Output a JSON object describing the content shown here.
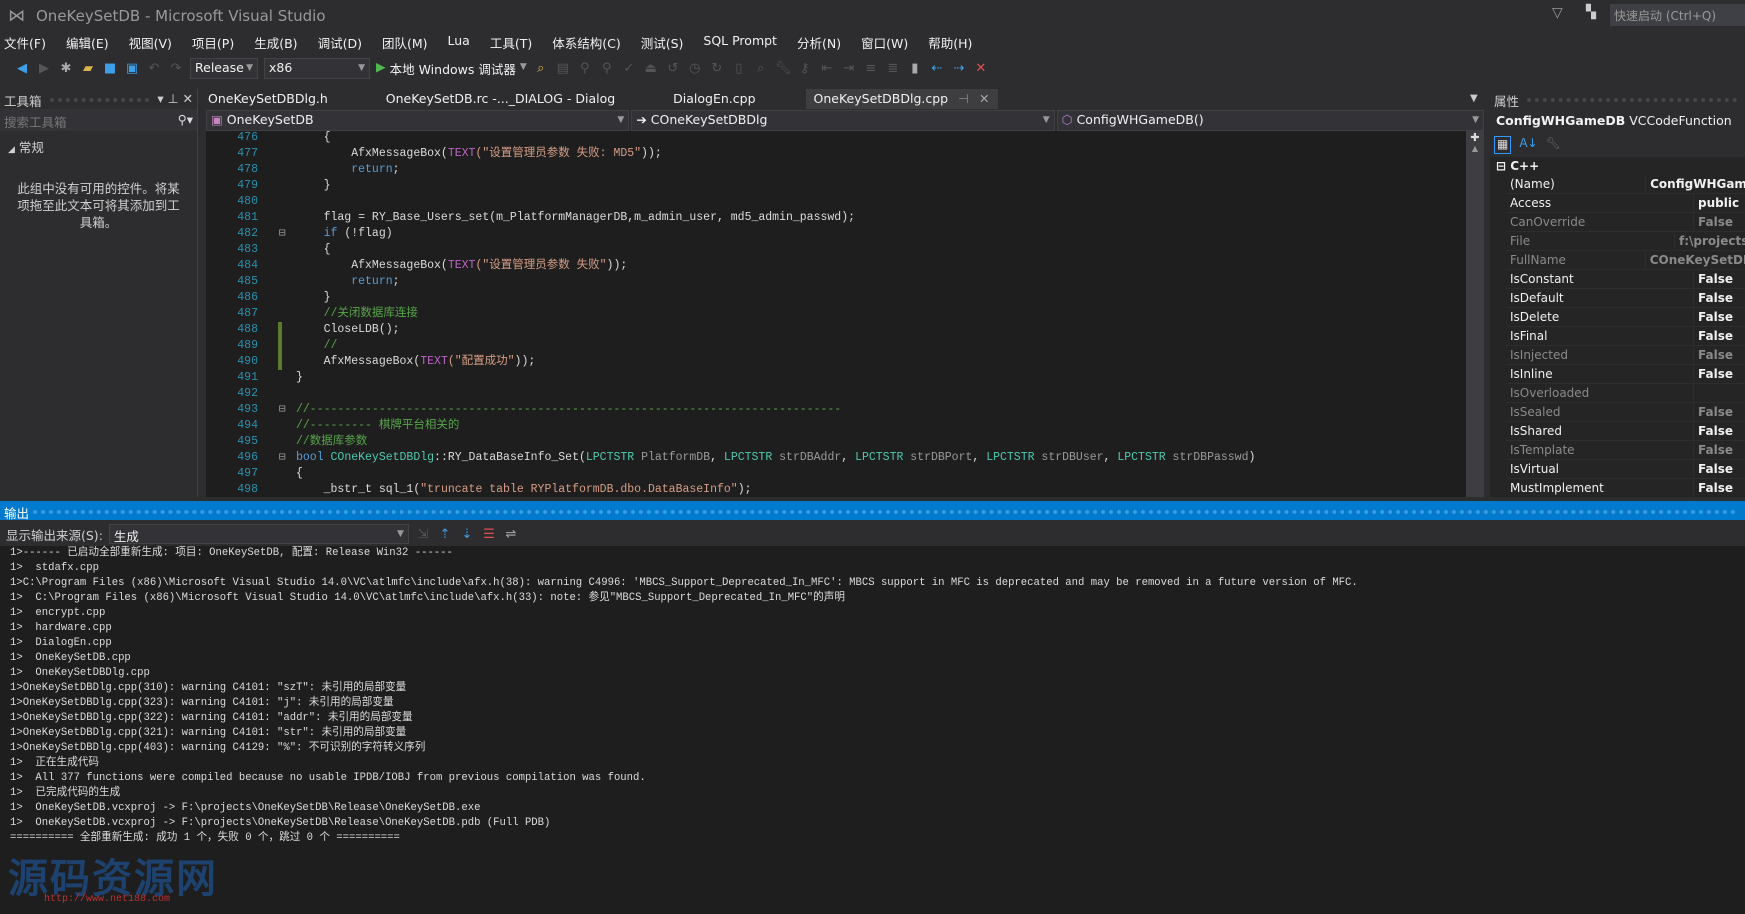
{
  "window": {
    "title": "OneKeySetDB - Microsoft Visual Studio",
    "quick_launch": "快速启动 (Ctrl+Q)"
  },
  "menu": [
    "文件(F)",
    "编辑(E)",
    "视图(V)",
    "项目(P)",
    "生成(B)",
    "调试(D)",
    "团队(M)",
    "Lua",
    "工具(T)",
    "体系结构(C)",
    "测试(S)",
    "SQL Prompt",
    "分析(N)",
    "窗口(W)",
    "帮助(H)"
  ],
  "toolbar": {
    "config": "Release",
    "platform": "x86",
    "run_label": "本地 Windows 调试器"
  },
  "toolbox": {
    "title": "工具箱",
    "search_placeholder": "搜索工具箱",
    "group": "常规",
    "empty_text": "此组中没有可用的控件。将某项拖至此文本可将其添加到工具箱。"
  },
  "tabs": [
    {
      "label": "OneKeySetDBDlg.h"
    },
    {
      "label": "OneKeySetDB.rc -..._DIALOG - Dialog"
    },
    {
      "label": "DialogEn.cpp"
    },
    {
      "label": "OneKeySetDBDlg.cpp",
      "active": true
    }
  ],
  "navbar": {
    "project": "OneKeySetDB",
    "class": "COneKeySetDBDlg",
    "member": "ConfigWHGameDB()"
  },
  "code": [
    {
      "n": "476",
      "t": [
        [
          "tx",
          "    {"
        ]
      ]
    },
    {
      "n": "477",
      "t": [
        [
          "tx",
          "        AfxMessageBox("
        ],
        [
          "mac",
          "TEXT"
        ],
        [
          "str",
          "(\"设置管理员参数 失败: MD5\""
        ],
        [
          "tx",
          "));"
        ]
      ]
    },
    {
      "n": "478",
      "t": [
        [
          "kw",
          "        return"
        ],
        [
          "tx",
          ";"
        ]
      ]
    },
    {
      "n": "479",
      "t": [
        [
          "tx",
          "    }"
        ]
      ]
    },
    {
      "n": "480",
      "t": []
    },
    {
      "n": "481",
      "t": [
        [
          "tx",
          "    flag = RY_Base_Users_set(m_PlatformManagerDB,m_admin_user, md5_admin_passwd);"
        ]
      ]
    },
    {
      "n": "482",
      "f": true,
      "t": [
        [
          "kw",
          "    if"
        ],
        [
          "tx",
          " (!flag)"
        ]
      ]
    },
    {
      "n": "483",
      "t": [
        [
          "tx",
          "    {"
        ]
      ]
    },
    {
      "n": "484",
      "t": [
        [
          "tx",
          "        AfxMessageBox("
        ],
        [
          "mac",
          "TEXT"
        ],
        [
          "str",
          "(\"设置管理员参数 失败\""
        ],
        [
          "tx",
          "));"
        ]
      ]
    },
    {
      "n": "485",
      "t": [
        [
          "kw",
          "        return"
        ],
        [
          "tx",
          ";"
        ]
      ]
    },
    {
      "n": "486",
      "t": [
        [
          "tx",
          "    }"
        ]
      ]
    },
    {
      "n": "487",
      "t": [
        [
          "cm",
          "    //关闭数据库连接"
        ]
      ]
    },
    {
      "n": "488",
      "c": true,
      "t": [
        [
          "tx",
          "    CloseLDB();"
        ]
      ]
    },
    {
      "n": "489",
      "c": true,
      "t": [
        [
          "cm",
          "    //"
        ]
      ]
    },
    {
      "n": "490",
      "c": true,
      "t": [
        [
          "tx",
          "    AfxMessageBox("
        ],
        [
          "mac",
          "TEXT"
        ],
        [
          "str",
          "(\"配置成功\""
        ],
        [
          "tx",
          "));"
        ]
      ]
    },
    {
      "n": "491",
      "t": [
        [
          "tx",
          "}"
        ]
      ]
    },
    {
      "n": "492",
      "t": []
    },
    {
      "n": "493",
      "f": true,
      "t": [
        [
          "cm",
          "//-----------------------------------------------------------------------------"
        ]
      ]
    },
    {
      "n": "494",
      "t": [
        [
          "cm",
          "//--------- 棋牌平台相关的"
        ]
      ]
    },
    {
      "n": "495",
      "t": [
        [
          "cm",
          "//数据库参数"
        ]
      ]
    },
    {
      "n": "496",
      "f": true,
      "t": [
        [
          "kw",
          "bool"
        ],
        [
          "tx",
          " "
        ],
        [
          "ty",
          "COneKeySetDBDlg"
        ],
        [
          "tx",
          "::RY_DataBaseInfo_Set("
        ],
        [
          "ty",
          "LPCTSTR"
        ],
        [
          "pr",
          " PlatformDB"
        ],
        [
          "tx",
          ", "
        ],
        [
          "ty",
          "LPCTSTR"
        ],
        [
          "pr",
          " strDBAddr"
        ],
        [
          "tx",
          ", "
        ],
        [
          "ty",
          "LPCTSTR"
        ],
        [
          "pr",
          " strDBPort"
        ],
        [
          "tx",
          ", "
        ],
        [
          "ty",
          "LPCTSTR"
        ],
        [
          "pr",
          " strDBUser"
        ],
        [
          "tx",
          ", "
        ],
        [
          "ty",
          "LPCTSTR"
        ],
        [
          "pr",
          " strDBPasswd"
        ],
        [
          "tx",
          ")"
        ]
      ]
    },
    {
      "n": "497",
      "t": [
        [
          "tx",
          "{"
        ]
      ]
    },
    {
      "n": "498",
      "t": [
        [
          "tx",
          "    _bstr_t sql_1("
        ],
        [
          "str",
          "\"truncate table RYPlatformDB.dbo.DataBaseInfo\""
        ],
        [
          "tx",
          ");"
        ]
      ]
    }
  ],
  "properties": {
    "title": "属性",
    "object_name": "ConfigWHGameDB",
    "object_type": "VCCodeFunction",
    "category": "C++",
    "rows": [
      {
        "name": "(Name)",
        "value": "ConfigWHGameDB"
      },
      {
        "name": "Access",
        "value": "public"
      },
      {
        "name": "CanOverride",
        "value": "False",
        "dim": true
      },
      {
        "name": "File",
        "value": "f:\\projects",
        "dim": true
      },
      {
        "name": "FullName",
        "value": "COneKeySetDBDlg",
        "dim": true
      },
      {
        "name": "IsConstant",
        "value": "False"
      },
      {
        "name": "IsDefault",
        "value": "False"
      },
      {
        "name": "IsDelete",
        "value": "False"
      },
      {
        "name": "IsFinal",
        "value": "False"
      },
      {
        "name": "IsInjected",
        "value": "False",
        "dim": true
      },
      {
        "name": "IsInline",
        "value": "False"
      },
      {
        "name": "IsOverloaded",
        "value": "",
        "dim": true
      },
      {
        "name": "IsSealed",
        "value": "False",
        "dim": true
      },
      {
        "name": "IsShared",
        "value": "False"
      },
      {
        "name": "IsTemplate",
        "value": "False",
        "dim": true
      },
      {
        "name": "IsVirtual",
        "value": "False"
      },
      {
        "name": "MustImplement",
        "value": "False"
      }
    ]
  },
  "output": {
    "title": "输出",
    "source_label": "显示输出来源(S):",
    "source_value": "生成",
    "lines": [
      "1>------ 已启动全部重新生成: 项目: OneKeySetDB, 配置: Release Win32 ------",
      "1>  stdafx.cpp",
      "1>C:\\Program Files (x86)\\Microsoft Visual Studio 14.0\\VC\\atlmfc\\include\\afx.h(38): warning C4996: 'MBCS_Support_Deprecated_In_MFC': MBCS support in MFC is deprecated and may be removed in a future version of MFC.",
      "1>  C:\\Program Files (x86)\\Microsoft Visual Studio 14.0\\VC\\atlmfc\\include\\afx.h(33): note: 参见\"MBCS_Support_Deprecated_In_MFC\"的声明",
      "1>  encrypt.cpp",
      "1>  hardware.cpp",
      "1>  DialogEn.cpp",
      "1>  OneKeySetDB.cpp",
      "1>  OneKeySetDBDlg.cpp",
      "1>OneKeySetDBDlg.cpp(310): warning C4101: \"szT\": 未引用的局部变量",
      "1>OneKeySetDBDlg.cpp(323): warning C4101: \"j\": 未引用的局部变量",
      "1>OneKeySetDBDlg.cpp(322): warning C4101: \"addr\": 未引用的局部变量",
      "1>OneKeySetDBDlg.cpp(321): warning C4101: \"str\": 未引用的局部变量",
      "1>OneKeySetDBDlg.cpp(403): warning C4129: \"%\": 不可识别的字符转义序列",
      "1>  正在生成代码",
      "1>  All 377 functions were compiled because no usable IPDB/IOBJ from previous compilation was found.",
      "1>  已完成代码的生成",
      "1>  OneKeySetDB.vcxproj -> F:\\projects\\OneKeySetDB\\Release\\OneKeySetDB.exe",
      "1>  OneKeySetDB.vcxproj -> F:\\projects\\OneKeySetDB\\Release\\OneKeySetDB.pdb (Full PDB)",
      "========== 全部重新生成: 成功 1 个，失败 0 个，跳过 0 个 =========="
    ]
  },
  "watermark": {
    "text": "源码资源网",
    "url": "http://www.net188.com"
  },
  "colors": {
    "accent": "#007acc",
    "editor_bg": "#1e1e1e",
    "keyword": "#569cd6",
    "string": "#d69d85",
    "comment": "#57a64a",
    "type": "#4ec9b0",
    "macro": "#bd63c5"
  }
}
